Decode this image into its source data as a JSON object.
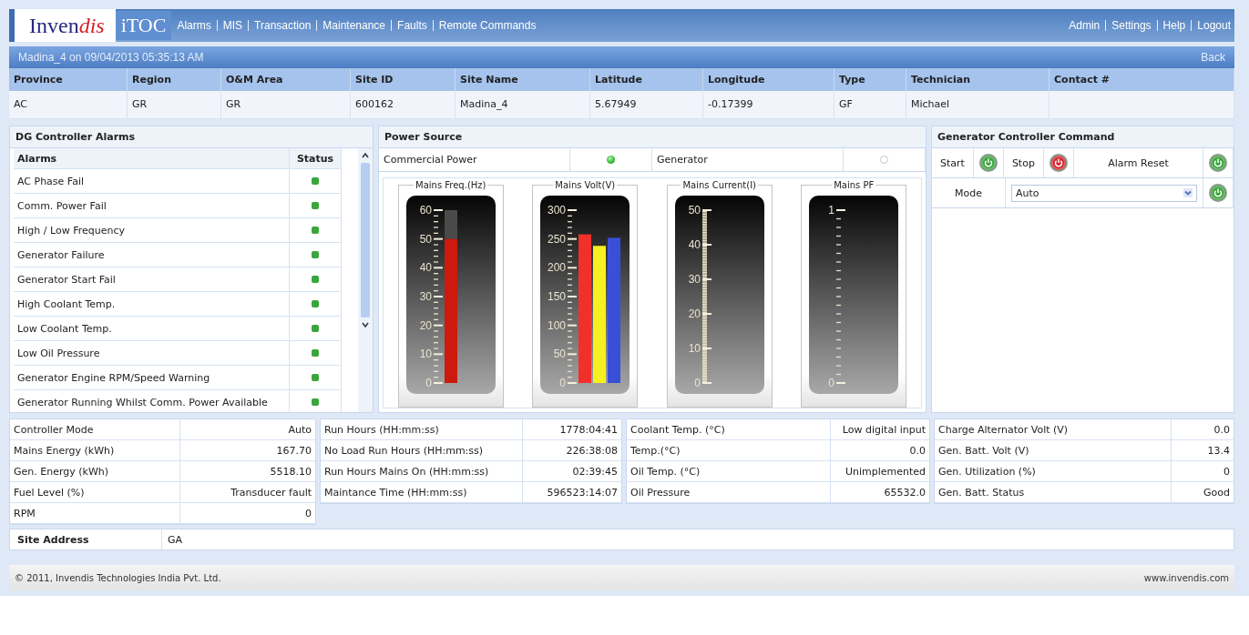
{
  "brand": {
    "name": "Inven",
    "accent": "dis",
    "product": "iTOC"
  },
  "nav": {
    "menu": [
      "Alarms",
      "MIS",
      "Transaction",
      "Maintenance",
      "Faults",
      "Remote Commands"
    ],
    "account": [
      "Admin",
      "Settings",
      "Help",
      "Logout"
    ]
  },
  "subheader": {
    "title": "Madina_4 on 09/04/2013 05:35:13 AM",
    "back": "Back"
  },
  "site": {
    "columns": [
      "Province",
      "Region",
      "O&M Area",
      "Site ID",
      "Site Name",
      "Latitude",
      "Longitude",
      "Type",
      "Technician",
      "Contact #"
    ],
    "row": [
      "AC",
      "GR",
      "GR",
      "600162",
      "Madina_4",
      "5.67949",
      "-0.17399",
      "GF",
      "Michael"
    ]
  },
  "alarms": {
    "title": "DG Controller Alarms",
    "columns": [
      "Alarms",
      "Status"
    ],
    "rows": [
      {
        "name": "AC Phase Fail",
        "color": "#3aa53a"
      },
      {
        "name": "Comm. Power Fail",
        "color": "#3aa53a"
      },
      {
        "name": "High / Low Frequency",
        "color": "#3aa53a"
      },
      {
        "name": "Generator Failure",
        "color": "#3aa53a"
      },
      {
        "name": "Generator Start Fail",
        "color": "#3aa53a"
      },
      {
        "name": "High Coolant Temp.",
        "color": "#3aa53a"
      },
      {
        "name": "Low Coolant Temp.",
        "color": "#3aa53a"
      },
      {
        "name": "Low Oil Pressure",
        "color": "#3aa53a"
      },
      {
        "name": "Generator Engine RPM/Speed Warning",
        "color": "#3aa53a"
      },
      {
        "name": "Generator Running Whilst Comm. Power Available",
        "color": "#3aa53a"
      }
    ]
  },
  "power_source": {
    "title": "Power Source",
    "sources": [
      {
        "name": "Commercial Power",
        "on": true
      },
      {
        "name": "Generator",
        "on": false
      }
    ],
    "gauges": [
      {
        "chart_data": {
          "type": "bar",
          "title": "Mains Freq.(Hz)",
          "categories": [
            null
          ],
          "ylim": [
            0,
            60
          ],
          "yticks": [
            0,
            10,
            20,
            30,
            40,
            50,
            60
          ],
          "series": [
            {
              "color": "#cc1a0e",
              "values": [
                50
              ]
            }
          ]
        }
      },
      {
        "chart_data": {
          "type": "bar",
          "title": "Mains Volt(V)",
          "categories": [
            null,
            null,
            null
          ],
          "ylim": [
            0,
            300
          ],
          "yticks": [
            0,
            50,
            100,
            150,
            200,
            250,
            300
          ],
          "series": [
            {
              "colors": [
                "#f0302a",
                "#f5f020",
                "#3a4fd8"
              ],
              "values": [
                258,
                238,
                252
              ]
            }
          ]
        }
      },
      {
        "title": "Mains Current(I)",
        "scale": [
          "50",
          "40",
          "30",
          "20",
          "10",
          "0"
        ]
      },
      {
        "title": "Mains PF",
        "scale": [
          "1",
          "0"
        ]
      }
    ]
  },
  "commands": {
    "title": "Generator Controller Command",
    "buttons": [
      {
        "label": "Start",
        "color": "#3aa53a"
      },
      {
        "label": "Stop",
        "color": "#d8252c"
      },
      {
        "label": "Alarm Reset",
        "color": "#3aa53a"
      }
    ],
    "mode": {
      "label": "Mode",
      "value": "Auto",
      "color": "#3aa53a"
    }
  },
  "readings": [
    [
      {
        "label": "Controller Mode",
        "value": "Auto"
      },
      {
        "label": "Mains Energy (kWh)",
        "value": "167.70"
      },
      {
        "label": "Gen. Energy (kWh)",
        "value": "5518.10"
      },
      {
        "label": "Fuel Level (%)",
        "value": "Transducer fault"
      },
      {
        "label": "RPM",
        "value": "0"
      }
    ],
    [
      {
        "label": "Run Hours (HH:mm:ss)",
        "value": "1778:04:41"
      },
      {
        "label": "No Load Run Hours (HH:mm:ss)",
        "value": "226:38:08"
      },
      {
        "label": "Run Hours Mains On (HH:mm:ss)",
        "value": "02:39:45"
      },
      {
        "label": "Maintance Time (HH:mm:ss)",
        "value": "596523:14:07"
      }
    ],
    [
      {
        "label": "Coolant Temp. (°C)",
        "value": "Low digital input"
      },
      {
        "label": "Temp.(°C)",
        "value": "0.0"
      },
      {
        "label": "Oil Temp. (°C)",
        "value": "Unimplemented"
      },
      {
        "label": "Oil Pressure",
        "value": "65532.0"
      }
    ],
    [
      {
        "label": "Charge Alternator Volt (V)",
        "value": "0.0"
      },
      {
        "label": "Gen. Batt. Volt (V)",
        "value": "13.4"
      },
      {
        "label": "Gen. Utilization (%)",
        "value": "0"
      },
      {
        "label": "Gen. Batt. Status",
        "value": "Good"
      }
    ]
  ],
  "site_address": {
    "label": "Site Address",
    "value": "GA"
  },
  "footer": {
    "copyright": "© 2011, Invendis Technologies India Pvt. Ltd.",
    "website": "www.invendis.com"
  }
}
